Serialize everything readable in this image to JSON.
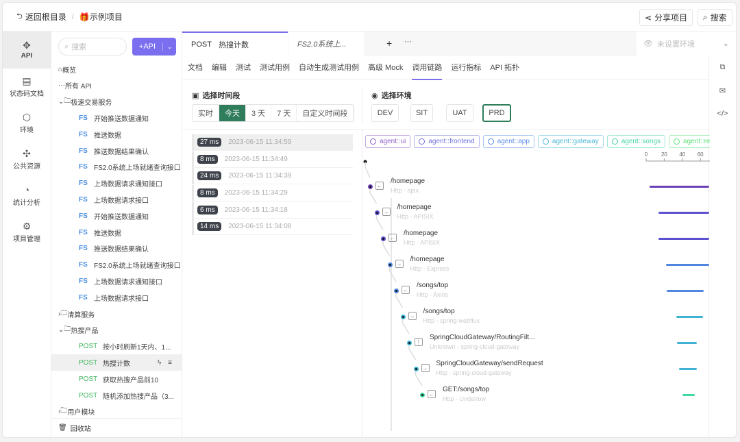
{
  "topbar": {
    "back": "返回根目录",
    "sep": "/",
    "project": "示例项目",
    "share": "分享项目",
    "search": "搜索"
  },
  "leftnav": [
    {
      "label": "API",
      "icon": "api-icon"
    },
    {
      "label": "状态码文档",
      "icon": "doc-icon"
    },
    {
      "label": "环境",
      "icon": "environment-icon"
    },
    {
      "label": "公共资源",
      "icon": "puzzle-icon"
    },
    {
      "label": "统计分析",
      "icon": "pie-chart-icon"
    },
    {
      "label": "项目管理",
      "icon": "gear-icon"
    }
  ],
  "tree": {
    "search_placeholder": "搜索",
    "add_api": "+API",
    "overview": "概览",
    "all_api": "所有 API",
    "folder1": "极速交易服务",
    "fs_items": [
      "开始推送数据通知",
      "推送数据",
      "推送数据结果确认",
      "FS2.0系统上场就绪查询接口",
      "上场数据请求通知接口",
      "上场数据请求接口",
      "开始推送数据通知",
      "推送数据",
      "推送数据结果确认",
      "FS2.0系统上场就绪查询接口",
      "上场数据请求通知接口",
      "上场数据请求接口"
    ],
    "fs_method": "FS",
    "folder2": "清算服务",
    "folder3": "热搜产品",
    "post_method": "POST",
    "post_items": [
      "按小时刷新1天内、1...",
      "热搜计数",
      "获取热搜产品前10",
      "随机添加热搜产品（3..."
    ],
    "folder4": "用户模块",
    "trash": "回收站"
  },
  "tabs": [
    {
      "method": "POST",
      "name": "热搜计数"
    },
    {
      "name": "FS2.0系统上..."
    }
  ],
  "env_select": "未设置环境",
  "subtabs": [
    "文档",
    "编辑",
    "测试",
    "测试用例",
    "自动生成测试用例",
    "高级 Mock",
    "调用链路",
    "运行指标",
    "API 拓扑"
  ],
  "time": {
    "title": "选择时间段",
    "options": [
      "实时",
      "今天",
      "3 天",
      "7 天",
      "自定义时间段"
    ],
    "selected": "今天"
  },
  "envs": {
    "title": "选择环境",
    "options": [
      "DEV",
      "SIT",
      "UAT",
      "PRD"
    ],
    "selected": "PRD"
  },
  "records": [
    {
      "ms": "27 ms",
      "time": "2023-06-15 11:34:59"
    },
    {
      "ms": "8 ms",
      "time": "2023-06-15 11:34:49"
    },
    {
      "ms": "24 ms",
      "time": "2023-06-15 11:34:39"
    },
    {
      "ms": "8 ms",
      "time": "2023-06-15 11:34:29"
    },
    {
      "ms": "6 ms",
      "time": "2023-06-15 11:34:18"
    },
    {
      "ms": "14 ms",
      "time": "2023-06-15 11:34:08"
    }
  ],
  "agents": [
    {
      "name": "agent::ui",
      "color": "#8b5cc7"
    },
    {
      "name": "agent::frontend",
      "color": "#7070e0"
    },
    {
      "name": "agent::app",
      "color": "#5a8de8"
    },
    {
      "name": "agent::gateway",
      "color": "#4bb6d6"
    },
    {
      "name": "agent::songs",
      "color": "#47d3a8"
    },
    {
      "name": "agent::recom",
      "color": "#5ee07a"
    }
  ],
  "axis_ticks": [
    "0",
    "20",
    "40",
    "60"
  ],
  "spans": [
    {
      "name": "/homepage",
      "sub": "Http - ajax",
      "color": "#6a3fb8",
      "start": 4,
      "end": 70
    },
    {
      "name": "/homepage",
      "sub": "Http - APISIX",
      "color": "#5b50d0",
      "start": 14,
      "end": 70
    },
    {
      "name": "/homepage",
      "sub": "Http - APISIX",
      "color": "#5b50d0",
      "start": 14,
      "end": 70
    },
    {
      "name": "/homepage",
      "sub": "Http - Express",
      "color": "#4f86e0",
      "start": 22,
      "end": 70
    },
    {
      "name": "/songs/top",
      "sub": "Http - Axios",
      "color": "#4f86e0",
      "start": 23,
      "end": 64
    },
    {
      "name": "/songs/top",
      "sub": "Http - spring-webflux",
      "color": "#3fb3d3",
      "start": 33,
      "end": 63
    },
    {
      "name": "SpringCloudGateway/RoutingFilt...",
      "sub": "Unknown - spring-cloud-gateway",
      "color": "#3fb3d3",
      "start": 34,
      "end": 56
    },
    {
      "name": "SpringCloudGateway/sendRequest",
      "sub": "Http - spring-cloud-gateway",
      "color": "#3fb3d3",
      "start": 36,
      "end": 56
    },
    {
      "name": "GET:/songs/top",
      "sub": "Http - Undertow",
      "color": "#3fd9a0",
      "start": 40,
      "end": 54
    }
  ]
}
